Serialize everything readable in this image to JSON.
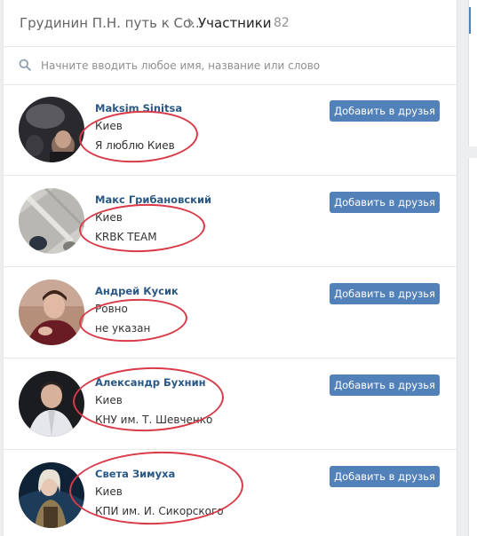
{
  "header": {
    "breadcrumb": "Грудинин П.Н. путь к Со..",
    "section": "Участники",
    "count": "82"
  },
  "search": {
    "placeholder": "Начните вводить любое имя, название или слово",
    "icon": "search-icon"
  },
  "colors": {
    "accent": "#5181b8",
    "link": "#2a5885",
    "highlight": "#d93a48"
  },
  "members": [
    {
      "name": "Maksim Sinitsa",
      "line1": "Киев",
      "line2": "Я люблю Киев",
      "action": "Добавить в друзья"
    },
    {
      "name": "Макс Грибановский",
      "line1": "Киев",
      "line2": "KRBK TEAM",
      "action": "Добавить в друзья"
    },
    {
      "name": "Андрей Кусик",
      "line1": "Ровно",
      "line2": "не указан",
      "action": "Добавить в друзья"
    },
    {
      "name": "Александр Бухнин",
      "line1": "Киев",
      "line2": "КНУ им. Т. Шевченко",
      "action": "Добавить в друзья"
    },
    {
      "name": "Света Зимуха",
      "line1": "Киев",
      "line2": "КПИ им. И. Сикорского",
      "action": "Добавить в друзья"
    }
  ]
}
